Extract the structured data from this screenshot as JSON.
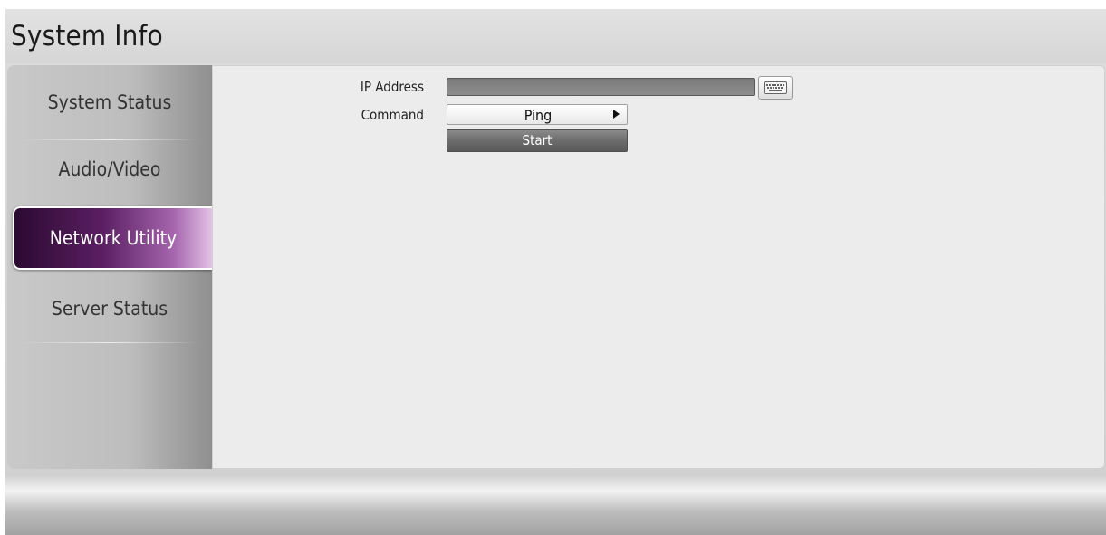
{
  "header": {
    "title": "System Info"
  },
  "sidebar": {
    "items": [
      {
        "label": "System Status",
        "active": false
      },
      {
        "label": "Audio/Video",
        "active": false
      },
      {
        "label": "Network Utility",
        "active": true
      },
      {
        "label": "Server Status",
        "active": false
      }
    ]
  },
  "form": {
    "ip_label": "IP Address",
    "ip_value": "",
    "keyboard_icon": "keyboard-icon",
    "command_label": "Command",
    "command_value": "Ping",
    "command_arrow_icon": "chevron-right-icon",
    "start_label": "Start"
  },
  "colors": {
    "active_tab_start": "#2a0930",
    "active_tab_end": "#e6c7e8",
    "content_bg": "#ececec",
    "start_button": "#6c6c6c"
  }
}
